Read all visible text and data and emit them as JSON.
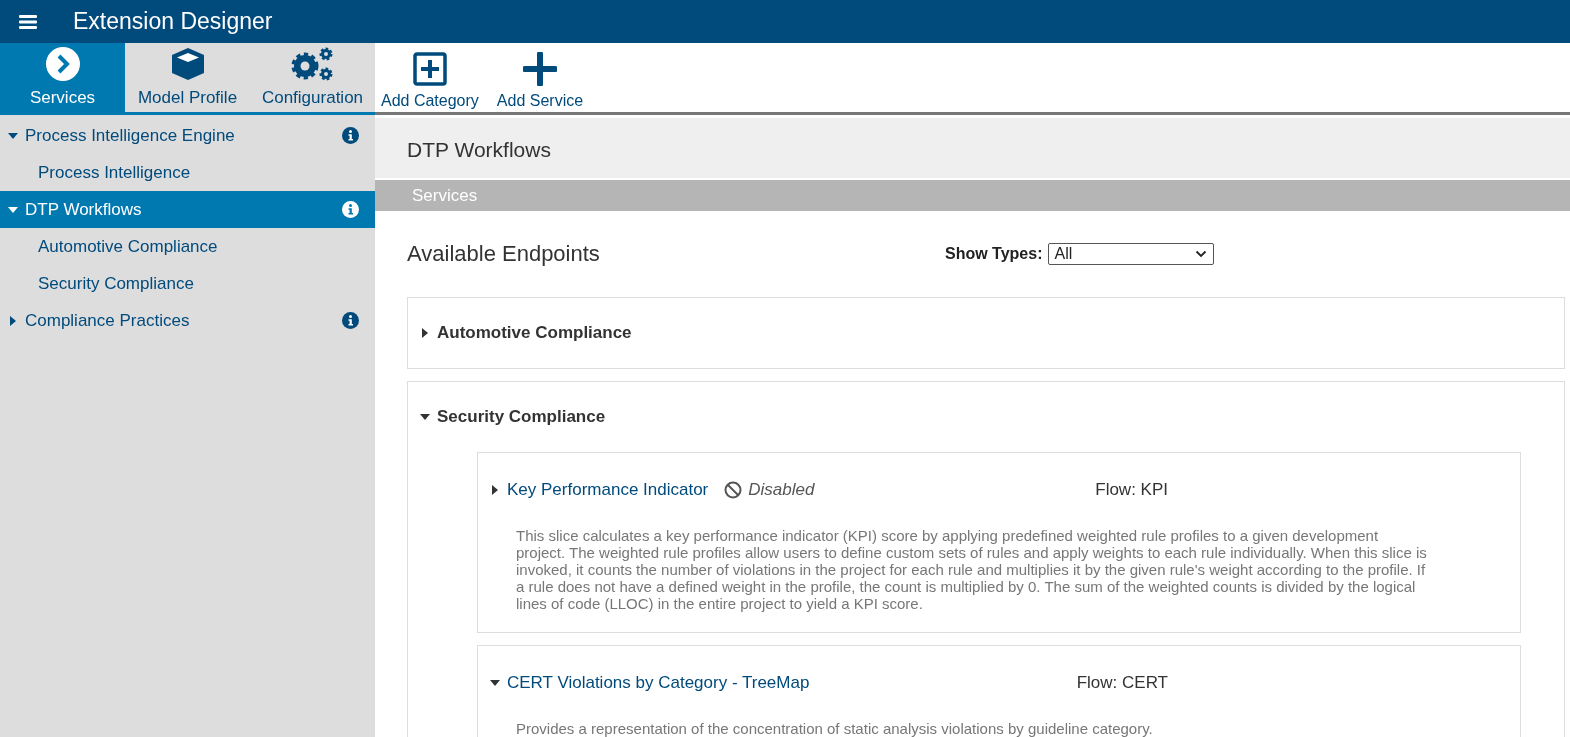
{
  "app_bar": {
    "title": "Extension Designer"
  },
  "tabs": [
    {
      "label": "Services",
      "selected": true
    },
    {
      "label": "Model Profile",
      "selected": false
    },
    {
      "label": "Configuration",
      "selected": false
    }
  ],
  "toolbar": [
    {
      "label": "Add Category"
    },
    {
      "label": "Add Service"
    }
  ],
  "sidebar": {
    "items": [
      {
        "label": "Process Intelligence Engine",
        "expanded": true,
        "selected": false,
        "children": [
          {
            "label": "Process Intelligence",
            "selected": false
          }
        ]
      },
      {
        "label": "DTP Workflows",
        "expanded": true,
        "selected": true,
        "children": [
          {
            "label": "Automotive Compliance",
            "selected": false
          },
          {
            "label": "Security Compliance",
            "selected": false
          }
        ]
      },
      {
        "label": "Compliance Practices",
        "expanded": false,
        "selected": false
      }
    ]
  },
  "page": {
    "title": "DTP Workflows",
    "section": "Services",
    "heading": "Available Endpoints",
    "filter": {
      "label": "Show Types:",
      "value": "All"
    },
    "categories": [
      {
        "name": "Automotive Compliance",
        "expanded": false
      },
      {
        "name": "Security Compliance",
        "expanded": true,
        "services": [
          {
            "name": "Key Performance Indicator",
            "expanded": false,
            "disabled": true,
            "status": "Disabled",
            "flow": "Flow: KPI",
            "description": "This slice calculates a key performance indicator (KPI) score by applying predefined weighted rule profiles to a given development project. The weighted rule profiles allow users to define custom sets of rules and apply weights to each rule individually. When this slice is invoked, it counts the number of violations in the project for each rule and multiplies it by the given rule's weight according to the profile. If a rule does not have a defined weight in the profile, the count is multiplied by 0. The sum of the weighted counts is divided by the logical lines of code (LLOC) in the entire project to yield a KPI score."
          },
          {
            "name": "CERT Violations by Category - TreeMap",
            "expanded": true,
            "disabled": false,
            "flow": "Flow: CERT",
            "description": "Provides a representation of the concentration of static analysis violations by guideline category."
          }
        ]
      }
    ]
  }
}
